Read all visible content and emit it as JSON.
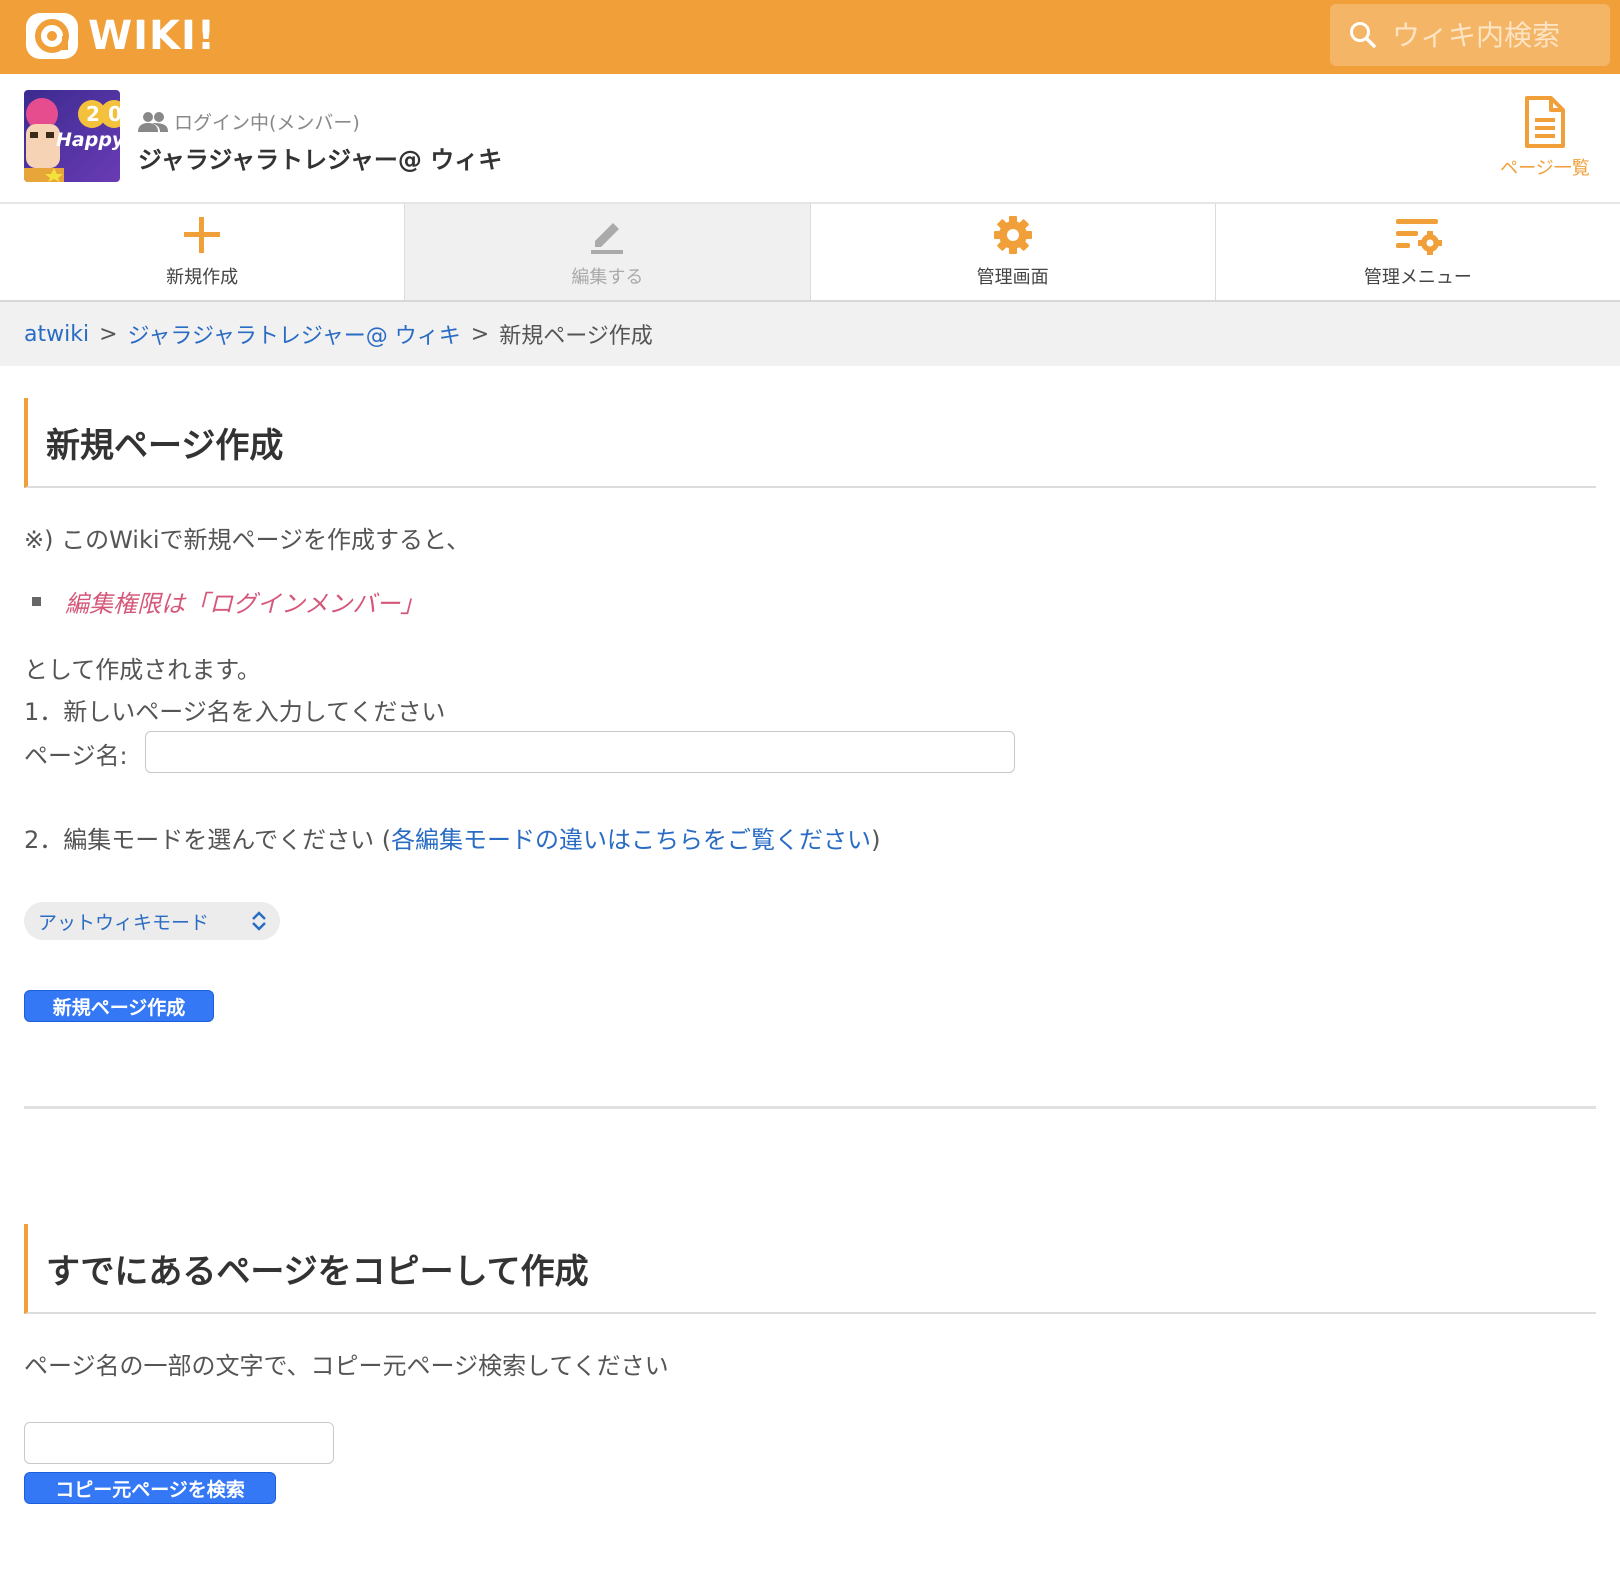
{
  "site": {
    "logo_text": "WIKI!"
  },
  "search": {
    "placeholder": "ウィキ内検索"
  },
  "header": {
    "login_status": "ログイン中(メンバー)",
    "wiki_title": "ジャラジャラトレジャー@ ウィキ",
    "page_list_label": "ページ一覧",
    "thumb_text": "Happy New"
  },
  "toolbar": {
    "new_label": "新規作成",
    "edit_label": "編集する",
    "admin_label": "管理画面",
    "menu_label": "管理メニュー"
  },
  "breadcrumb": {
    "root": "atwiki",
    "wiki": "ジャラジャラトレジャー@ ウィキ",
    "current": "新規ページ作成",
    "sep": ">"
  },
  "create": {
    "heading": "新規ページ作成",
    "note_intro": "※) このWikiで新規ページを作成すると、",
    "note_item": "編集権限は「ログインメンバー」",
    "note_outro": "として作成されます。",
    "step1": "1．新しいページ名を入力してください",
    "page_name_label": "ページ名:",
    "page_name_value": "",
    "step2_prefix": "2．編集モードを選んでください (",
    "step2_link": "各編集モードの違いはこちらをご覧ください",
    "step2_suffix": ")",
    "mode_selected": "アットウィキモード",
    "submit_label": "新規ページ作成"
  },
  "copy": {
    "heading": "すでにあるページをコピーして作成",
    "instruction": "ページ名の一部の文字で、コピー元ページ検索してください",
    "search_value": "",
    "search_button": "コピー元ページを検索"
  },
  "colors": {
    "accent": "#f19f39",
    "link": "#2a6cc4",
    "button": "#3478f6",
    "note": "#d5587a"
  }
}
